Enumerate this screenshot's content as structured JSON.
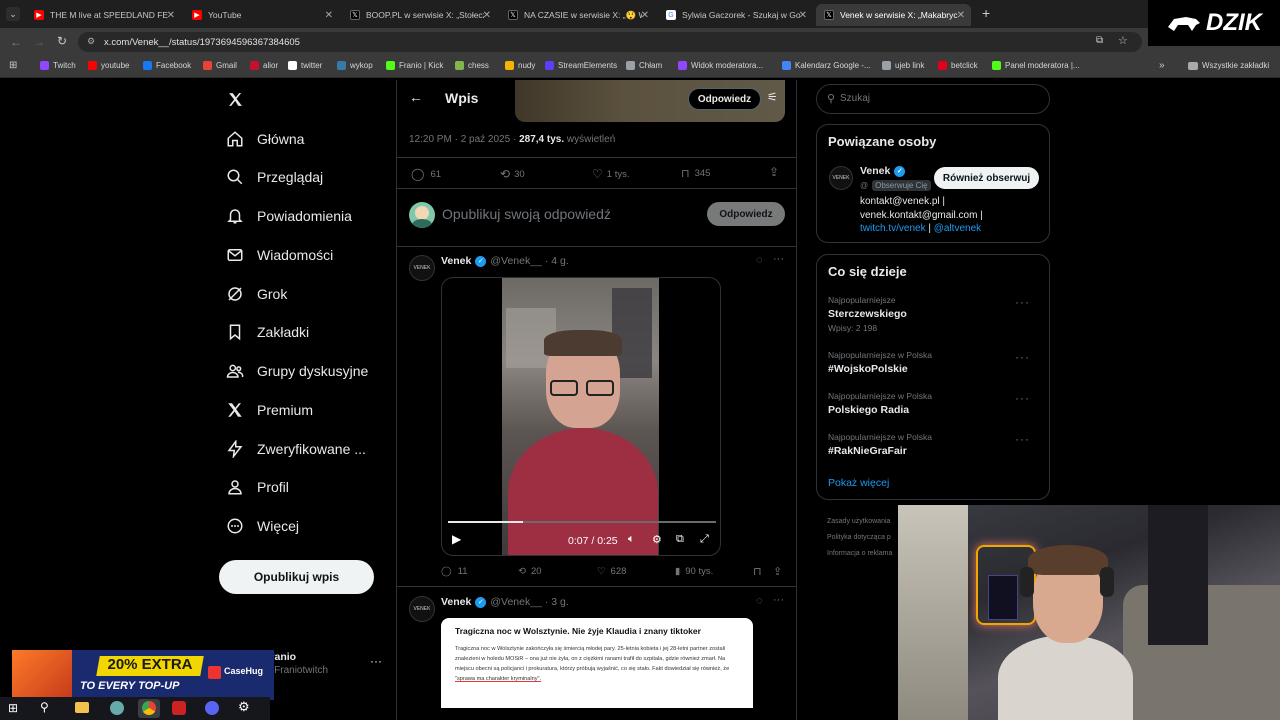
{
  "browser": {
    "tabs": [
      {
        "title": "THE M live at SPEEDLAND FEST",
        "favicon": "youtube-icon",
        "active": false
      },
      {
        "title": "YouTube",
        "favicon": "youtube-icon",
        "active": false
      },
      {
        "title": "BOOP.PL w serwisie X: „Stołeczn",
        "favicon": "x-icon",
        "active": false
      },
      {
        "title": "NA CZASIE w serwisie X: „😲 W",
        "favicon": "x-icon",
        "active": false
      },
      {
        "title": "Sylwia Gaczorek - Szukaj w Goo",
        "favicon": "google-icon",
        "active": false
      },
      {
        "title": "Venek w serwisie X: „Makabryc",
        "favicon": "x-icon",
        "active": true
      }
    ],
    "new_tab": "+",
    "url": "x.com/Venek__/status/1973694596367384605",
    "bookmarks": [
      {
        "label": "Twitch",
        "color": "#9146ff"
      },
      {
        "label": "youtube",
        "color": "#ff0000"
      },
      {
        "label": "Facebook",
        "color": "#1877f2"
      },
      {
        "label": "Gmail",
        "color": "#ea4335"
      },
      {
        "label": "alior",
        "color": "#c8102e"
      },
      {
        "label": "twitter",
        "color": "#ffffff"
      },
      {
        "label": "wykop",
        "color": "#367aa9"
      },
      {
        "label": "Franio | Kick",
        "color": "#53fc18"
      },
      {
        "label": "chess",
        "color": "#81b64c"
      },
      {
        "label": "nudy",
        "color": "#f4b400"
      },
      {
        "label": "StreamElements",
        "color": "#5c3ef6"
      },
      {
        "label": "Chłam",
        "color": "#9aa0a6"
      },
      {
        "label": "Widok moderatora...",
        "color": "#9146ff"
      },
      {
        "label": "Kalendarz Google -...",
        "color": "#4285f4"
      },
      {
        "label": "ujeb link",
        "color": "#9aa0a6"
      },
      {
        "label": "betclick",
        "color": "#e3001b"
      },
      {
        "label": "Panel moderatora |...",
        "color": "#53fc18"
      }
    ],
    "bookmarks_more": "»",
    "all_bookmarks": "Wszystkie zakładki"
  },
  "brand_logo": "DZIK",
  "nav": {
    "items": [
      {
        "label": "Główna",
        "icon": "home-icon"
      },
      {
        "label": "Przeglądaj",
        "icon": "search-icon"
      },
      {
        "label": "Powiadomienia",
        "icon": "bell-icon"
      },
      {
        "label": "Wiadomości",
        "icon": "envelope-icon"
      },
      {
        "label": "Grok",
        "icon": "grok-icon"
      },
      {
        "label": "Zakładki",
        "icon": "bookmark-icon"
      },
      {
        "label": "Grupy dyskusyjne",
        "icon": "people-icon"
      },
      {
        "label": "Premium",
        "icon": "x-icon"
      },
      {
        "label": "Zweryfikowane ...",
        "icon": "lightning-icon"
      },
      {
        "label": "Profil",
        "icon": "person-icon"
      },
      {
        "label": "Więcej",
        "icon": "more-circle-icon"
      }
    ],
    "post_button": "Opublikuj wpis",
    "account_name": "Franio",
    "account_handle": "@Franiotwitch"
  },
  "header": {
    "title": "Wpis",
    "reply_button": "Odpowiedz"
  },
  "main_post": {
    "time": "12:20 PM · 2 paź 2025 · ",
    "views_count": "287,4 tys.",
    "views_label": " wyświetleń",
    "replies": "61",
    "reposts": "30",
    "likes": "1 tys.",
    "bookmarks": "345"
  },
  "composer": {
    "placeholder": "Opublikuj swoją odpowiedź",
    "button": "Odpowiedz"
  },
  "reply1": {
    "name": "Venek",
    "handle": "@Venek__",
    "time": "· 4 g.",
    "video_time": "0:07 / 0:25",
    "video_progress": 0.28,
    "replies": "11",
    "reposts": "20",
    "likes": "628",
    "views": "90 tys."
  },
  "reply2": {
    "name": "Venek",
    "handle": "@Venek__",
    "time": "· 3 g.",
    "article_title": "Tragiczna noc w Wolsztynie. Nie żyje Klaudia i znany tiktoker",
    "article_body": "Tragiczna noc w Wolsztynie zakończyła się śmiercią młodej pary. 25-letnia kobieta i jej 28-letni partner zostali znalezieni w holedu MOSiR – ona już nie żyła, on z ciężkimi ranami trafił do szpitala, gdzie również zmarł. Na miejscu obecni są policjanci i prokuratura, którzy próbują wyjaśnić, co się stało. Fakt dowiedział się również, że",
    "article_highlight": "\"sprawa ma charakter kryminalny\"."
  },
  "right": {
    "search_placeholder": "Szukaj",
    "related_title": "Powiązane osoby",
    "profile_name": "Venek",
    "profile_handle": "@",
    "follows_you": "Obserwuje Cię",
    "follow_back": "Również obserwuj",
    "bio_line1": "kontakt@venek.pl |",
    "bio_line2": "venek.kontakt@gmail.com |",
    "bio_link1": "twitch.tv/venek",
    "bio_sep": " | ",
    "bio_link2": "@altvenek",
    "trends_title": "Co się dzieje",
    "trends": [
      {
        "context": "Najpopularniejsze",
        "name": "Sterczewskiego",
        "count": "Wpisy: 2 198"
      },
      {
        "context": "Najpopularniejsze w Polska",
        "name": "#WojskoPolskie",
        "count": ""
      },
      {
        "context": "Najpopularniejsze w Polska",
        "name": "Polskiego Radia",
        "count": ""
      },
      {
        "context": "Najpopularniejsze w Polska",
        "name": "#RakNieGraFair",
        "count": ""
      }
    ],
    "show_more": "Pokaż więcej",
    "footer": [
      "Zasady użytkowania",
      "Polityka dotycząca p",
      "Informacja o reklama"
    ]
  },
  "ad": {
    "headline": "20% EXTRA",
    "subline": "TO EVERY TOP-UP",
    "brand": "CaseHug"
  },
  "colors": {
    "accent": "#1d9bf0",
    "bg": "#000000",
    "border": "#2f3336",
    "muted": "#71767b"
  }
}
